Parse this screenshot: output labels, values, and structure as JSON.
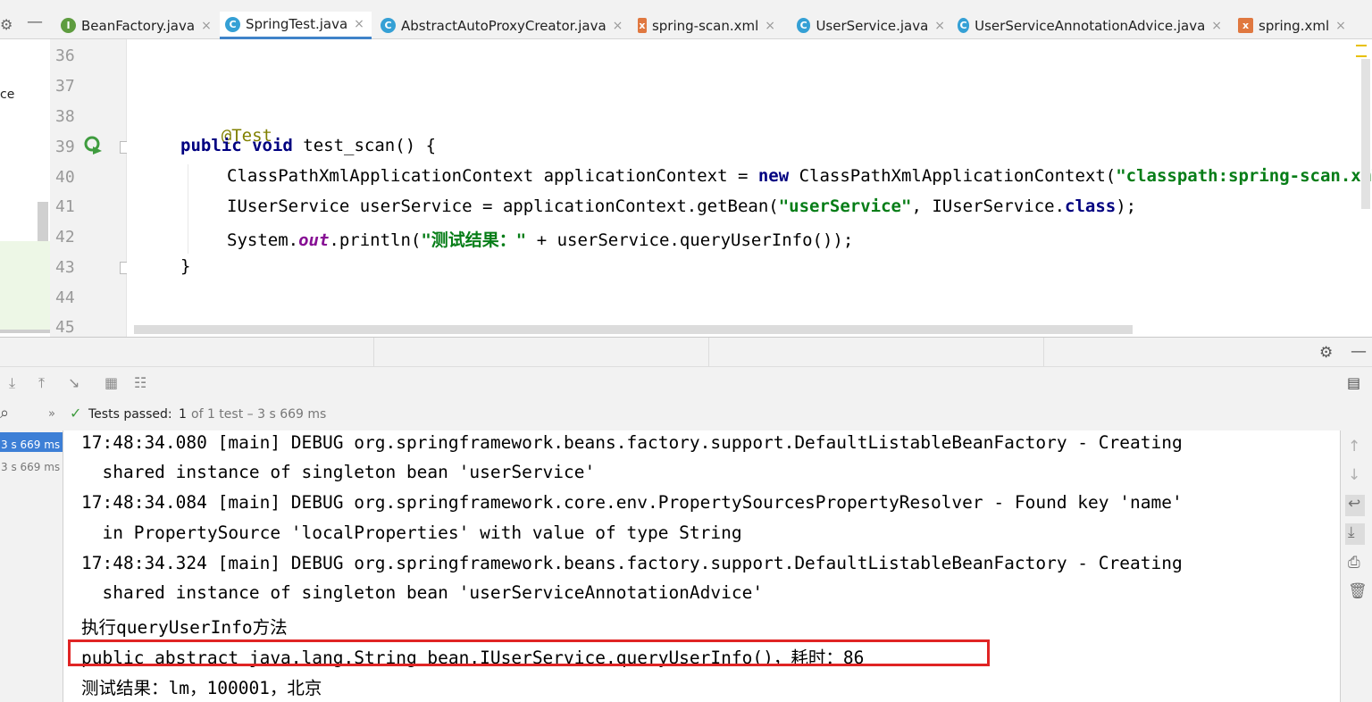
{
  "tabs": [
    {
      "label": "BeanFactory.java",
      "icon": "interface-file-icon",
      "kind": "i"
    },
    {
      "label": "SpringTest.java",
      "icon": "class-file-icon",
      "kind": "c"
    },
    {
      "label": "AbstractAutoProxyCreator.java",
      "icon": "class-file-icon",
      "kind": "c"
    },
    {
      "label": "spring-scan.xml",
      "icon": "xml-file-icon",
      "kind": "x"
    },
    {
      "label": "UserService.java",
      "icon": "class-file-icon",
      "kind": "c"
    },
    {
      "label": "UserServiceAnnotationAdvice.java",
      "icon": "class-file-icon",
      "kind": "c"
    },
    {
      "label": "spring.xml",
      "icon": "xml-file-icon",
      "kind": "x"
    }
  ],
  "left_panel": {
    "fragment": "ce"
  },
  "gutter": {
    "line_numbers": [
      "36",
      "37",
      "38",
      "39",
      "40",
      "41",
      "42",
      "43",
      "44",
      "45"
    ]
  },
  "code": {
    "line38": {
      "annotation": "@Test"
    },
    "line39": {
      "kw1": "public",
      "kw2": "void",
      "rest": " test_scan() {"
    },
    "line40": {
      "a": "ClassPathXmlApplicationContext applicationContext = ",
      "kw": "new",
      "b": " ClassPathXmlApplicationContext(",
      "str": "\"classpath:spring-scan.xml\"",
      "c": ");"
    },
    "line41": {
      "a": "IUserService userService = applicationContext.getBean(",
      "str": "\"userService\"",
      "b": ", IUserService.",
      "kw": "class",
      "c": ");"
    },
    "line42": {
      "a": "System.",
      "field": "out",
      "b": ".println(",
      "str": "\"测试结果：\"",
      "c": " + userService.queryUserInfo());"
    },
    "line43": {
      "text": "}"
    }
  },
  "test_status": {
    "label": "Tests passed:",
    "count": "1",
    "rest": "of 1 test – 3 s 669 ms"
  },
  "test_tree": {
    "root_time": "3 s 669 ms",
    "child_time": "3 s 669 ms"
  },
  "console": {
    "lines": [
      "17:48:34.080 [main] DEBUG org.springframework.beans.factory.support.DefaultListableBeanFactory - Creating",
      "  shared instance of singleton bean 'userService'",
      "17:48:34.084 [main] DEBUG org.springframework.core.env.PropertySourcesPropertyResolver - Found key 'name'",
      "  in PropertySource 'localProperties' with value of type String",
      "17:48:34.324 [main] DEBUG org.springframework.beans.factory.support.DefaultListableBeanFactory - Creating",
      "  shared instance of singleton bean 'userServiceAnnotationAdvice'",
      "执行queryUserInfo方法",
      "public abstract java.lang.String bean.IUserService.queryUserInfo()，耗时：86",
      "测试结果：lm，100001，北京"
    ],
    "highlight_color": "#e02424"
  },
  "colors": {
    "keyword": "#000080",
    "string": "#067d17",
    "annotation": "#808000",
    "static_field": "#871094",
    "pass_green": "#3f9c3f",
    "selection": "#3d7fd6"
  }
}
